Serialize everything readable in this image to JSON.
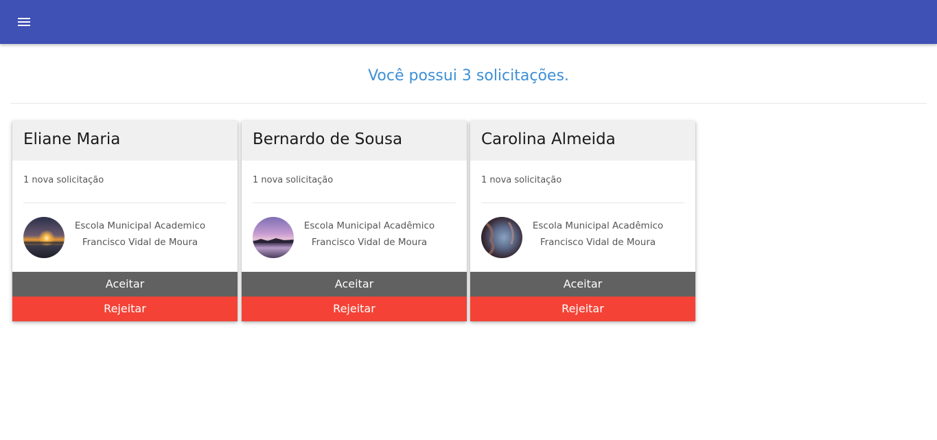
{
  "header": {
    "menu_icon": "hamburger-menu-icon",
    "color": "#3f51b5"
  },
  "main": {
    "heading": "Você possui 3 solicitações."
  },
  "requests": [
    {
      "name": "Eliane Maria",
      "subtitle": "1 nova solicitação",
      "school_line1": "Escola Municipal Academico",
      "school_line2": "Francisco Vidal de Moura",
      "accept_label": "Aceitar",
      "reject_label": "Rejeitar"
    },
    {
      "name": "Bernardo de Sousa",
      "subtitle": "1 nova solicitação",
      "school_line1": "Escola Municipal Acadêmico",
      "school_line2": "Francisco Vidal de Moura",
      "accept_label": "Aceitar",
      "reject_label": "Rejeitar"
    },
    {
      "name": "Carolina Almeida",
      "subtitle": "1 nova solicitação",
      "school_line1": "Escola Municipal Acadêmico",
      "school_line2": "Francisco Vidal de Moura",
      "accept_label": "Aceitar",
      "reject_label": "Rejeitar"
    }
  ],
  "colors": {
    "heading": "#3d8fd6",
    "accept": "#616161",
    "reject": "#f44336"
  }
}
